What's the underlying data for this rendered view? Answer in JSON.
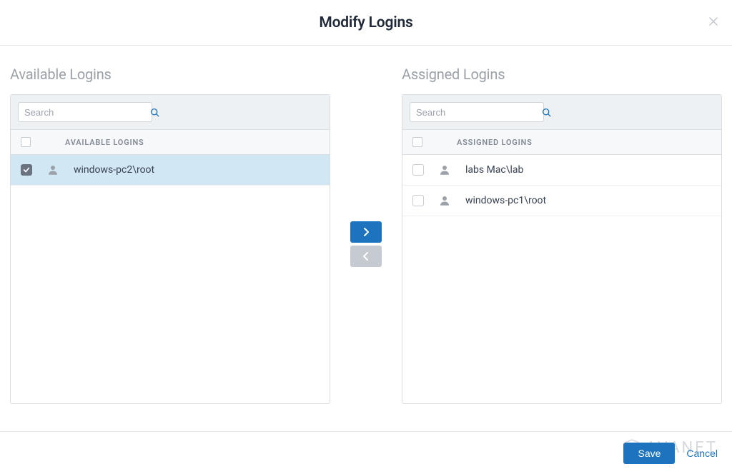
{
  "header": {
    "title": "Modify Logins"
  },
  "available": {
    "title": "Available Logins",
    "search_placeholder": "Search",
    "column_label": "AVAILABLE LOGINS",
    "rows": [
      {
        "label": "windows-pc2\\root",
        "checked": true
      }
    ]
  },
  "assigned": {
    "title": "Assigned Logins",
    "search_placeholder": "Search",
    "column_label": "ASSIGNED LOGINS",
    "rows": [
      {
        "label": "labs Mac\\lab",
        "checked": false
      },
      {
        "label": "windows-pc1\\root",
        "checked": false
      }
    ]
  },
  "footer": {
    "save_label": "Save",
    "cancel_label": "Cancel"
  },
  "watermark": {
    "text": "AVANET"
  }
}
